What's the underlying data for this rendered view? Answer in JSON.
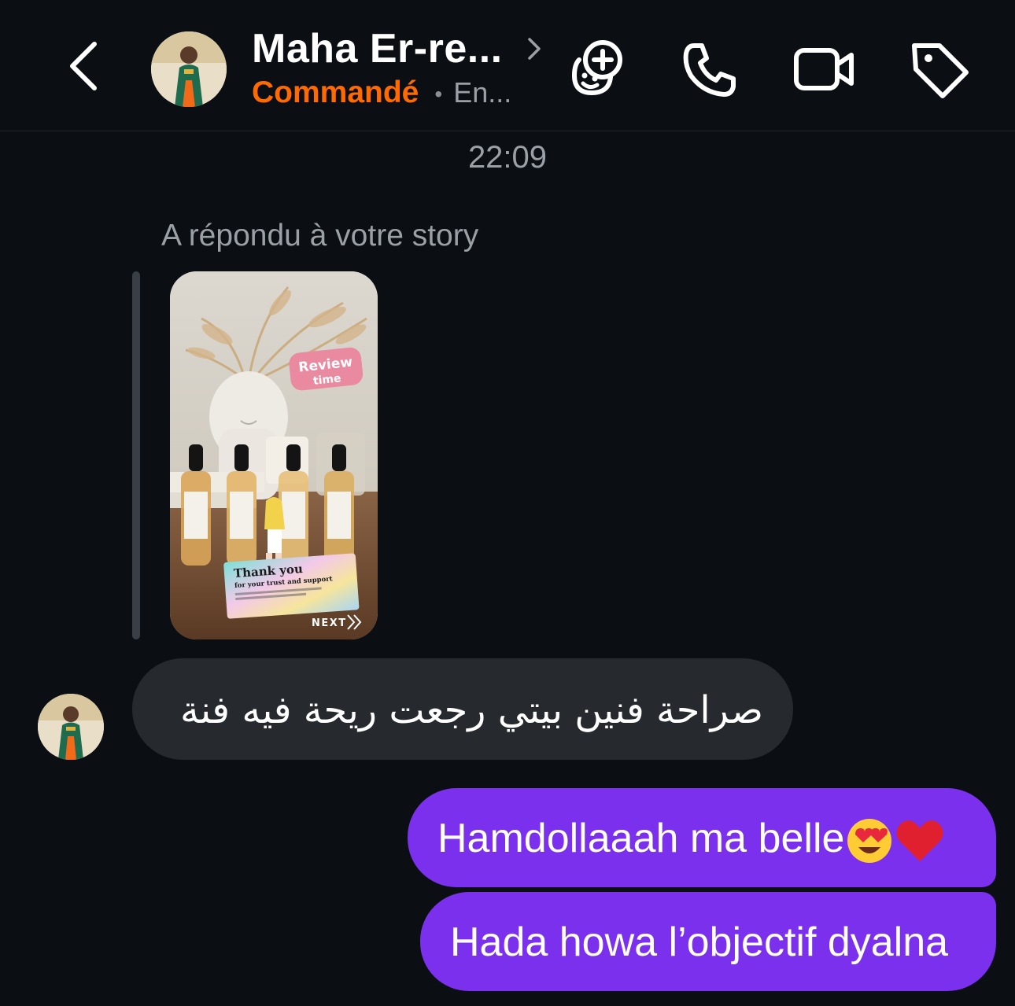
{
  "header": {
    "contact_name": "Maha Er-re...",
    "status": "Commandé",
    "separator": "•",
    "extra_status": "En..."
  },
  "icons": {
    "back": "chevron-left-icon",
    "name_chevron": "chevron-right-icon",
    "games": "games-add-icon",
    "call": "phone-icon",
    "video": "video-camera-icon",
    "label": "tag-icon"
  },
  "conversation": {
    "timestamp": "22:09",
    "story_reply_label": "A répondu à votre story",
    "story_card": {
      "sticker": "Review time",
      "caption_title": "Thank you",
      "caption_sub": "for your trust and support",
      "next_label": "NEXT"
    },
    "incoming": [
      {
        "text": "صراحة فنين بيتي رجعت ريحة فيه فنة"
      }
    ],
    "outgoing": [
      {
        "text": "Hamdollaaah ma belle",
        "emojis": [
          "heart-eyes-emoji",
          "red-heart-emoji"
        ]
      },
      {
        "text": "Hada howa l’objectif dyalna"
      }
    ]
  },
  "colors": {
    "background": "#0b0f13",
    "status_orange": "#ff6a00",
    "incoming_bubble": "#262a2f",
    "outgoing_bubble": "#7b30ee",
    "muted_text": "#9aa0a6"
  }
}
